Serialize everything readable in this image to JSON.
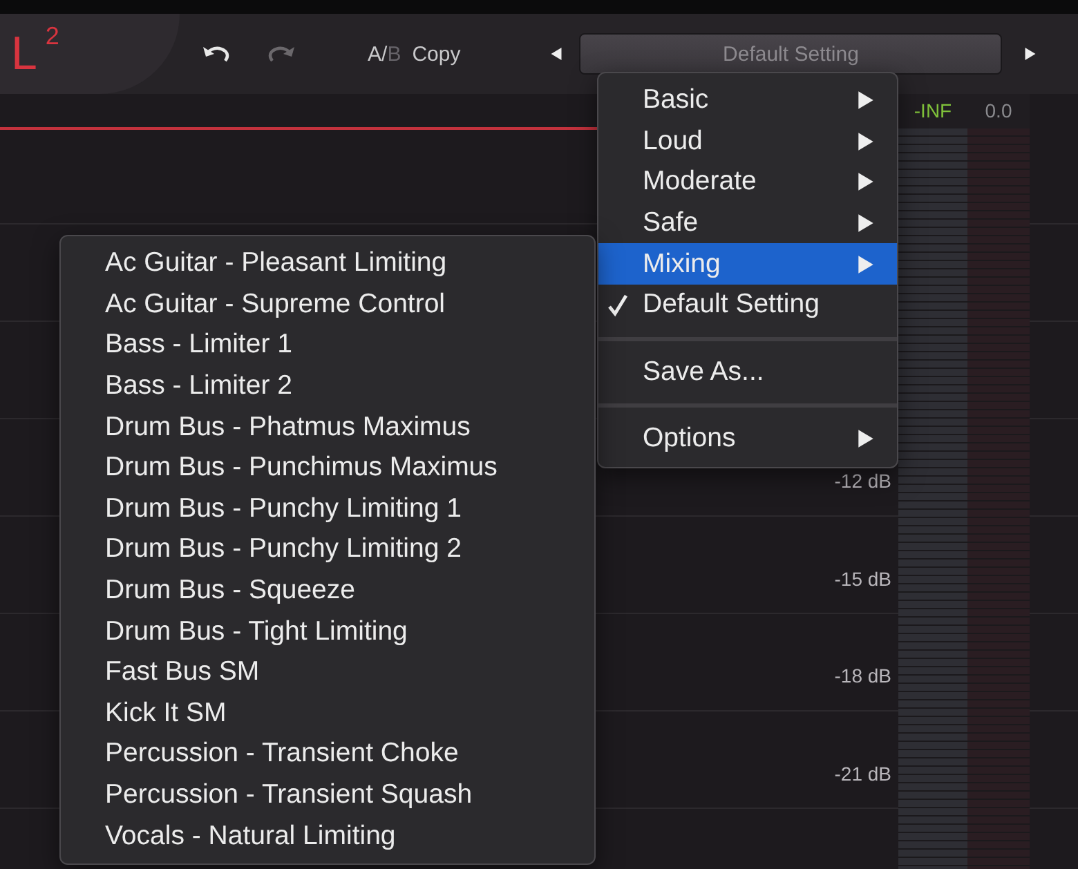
{
  "toolbar": {
    "logo": "L",
    "logo_superscript": "2",
    "undo": {
      "disabled": false
    },
    "redo": {
      "disabled": true
    },
    "ab_options": [
      {
        "label": "A",
        "selected": true
      },
      {
        "label": "B",
        "selected": false
      }
    ],
    "ab_separator": "/",
    "copy": "Copy",
    "preset": "Default Setting"
  },
  "meter_headers": [
    {
      "label": "-INF",
      "color": "#7fc13a"
    },
    {
      "label": "0.0",
      "color": "#8a8a8e"
    }
  ],
  "scale": [
    "-12 dB",
    "-15 dB",
    "-18 dB",
    "-21 dB"
  ],
  "menu": {
    "items": [
      {
        "kind": "submenu",
        "label": "Basic",
        "selected": false,
        "checked": false
      },
      {
        "kind": "submenu",
        "label": "Loud",
        "selected": false,
        "checked": false
      },
      {
        "kind": "submenu",
        "label": "Moderate",
        "selected": false,
        "checked": false
      },
      {
        "kind": "submenu",
        "label": "Safe",
        "selected": false,
        "checked": false
      },
      {
        "kind": "submenu",
        "label": "Mixing",
        "selected": true,
        "checked": false
      },
      {
        "kind": "item",
        "label": "Default Setting",
        "selected": false,
        "checked": true
      },
      {
        "kind": "separator"
      },
      {
        "kind": "item",
        "label": "Save As...",
        "selected": false,
        "checked": false
      },
      {
        "kind": "separator"
      },
      {
        "kind": "submenu",
        "label": "Options",
        "selected": false,
        "checked": false
      }
    ]
  },
  "submenu": {
    "items": [
      "Ac Guitar - Pleasant Limiting",
      "Ac Guitar - Supreme Control",
      "Bass - Limiter 1",
      "Bass - Limiter 2",
      "Drum Bus - Phatmus Maximus",
      "Drum Bus - Punchimus Maximus",
      "Drum Bus - Punchy Limiting 1",
      "Drum Bus - Punchy Limiting 2",
      "Drum Bus - Squeeze",
      "Drum Bus - Tight Limiting",
      "Fast Bus SM",
      "Kick It SM",
      "Percussion - Transient Choke",
      "Percussion - Transient Squash",
      "Vocals - Natural Limiting"
    ]
  }
}
